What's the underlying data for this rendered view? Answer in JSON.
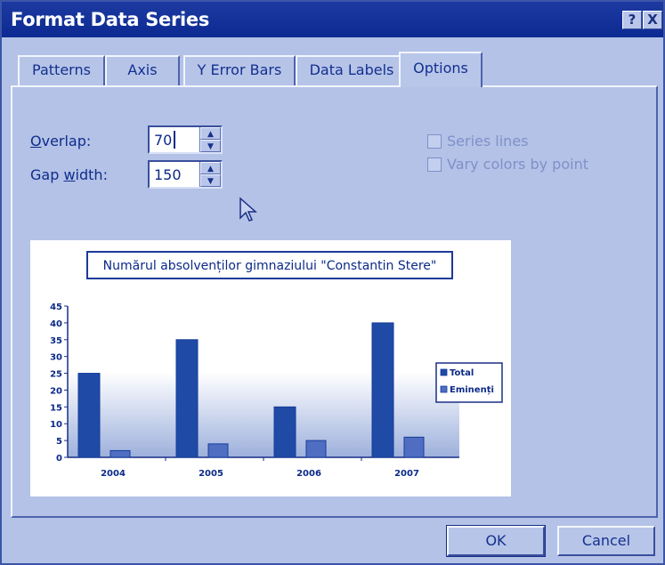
{
  "window": {
    "title": "Format Data Series",
    "help_label": "?",
    "close_label": "X"
  },
  "tabs": [
    {
      "label": "Patterns"
    },
    {
      "label": "Axis"
    },
    {
      "label": "Y Error Bars"
    },
    {
      "label": "Data Labels"
    },
    {
      "label": "Options"
    }
  ],
  "options": {
    "overlap_label_pre": "",
    "overlap_label_u": "O",
    "overlap_label_post": "verlap:",
    "overlap_value": "70",
    "gap_label_pre": "Gap ",
    "gap_label_u": "w",
    "gap_label_post": "idth:",
    "gap_value": "150",
    "series_lines_label": "Series lines",
    "vary_colors_label": "Vary colors by point"
  },
  "chart_data": {
    "type": "bar",
    "title": "Numărul absolvenților gimnaziului \"Constantin Stere\"",
    "categories": [
      "2004",
      "2005",
      "2006",
      "2007"
    ],
    "series": [
      {
        "name": "Total",
        "values": [
          25,
          35,
          15,
          40
        ],
        "color": "#1f4aa6"
      },
      {
        "name": "Eminenți",
        "values": [
          2,
          4,
          5,
          6
        ],
        "color": "#4f6ec2"
      }
    ],
    "ylim": [
      0,
      45
    ],
    "yticks": [
      "0",
      "5",
      "10",
      "15",
      "20",
      "25",
      "30",
      "35",
      "40",
      "45"
    ],
    "legend_position": "right",
    "grid": false
  },
  "buttons": {
    "ok_label": "OK",
    "cancel_label": "Cancel"
  },
  "colors": {
    "titlebar": "#1c3aa0",
    "dialog_bg": "#b3c2e6",
    "bar_primary": "#1f4aa6",
    "bar_secondary": "#4f6ec2"
  }
}
